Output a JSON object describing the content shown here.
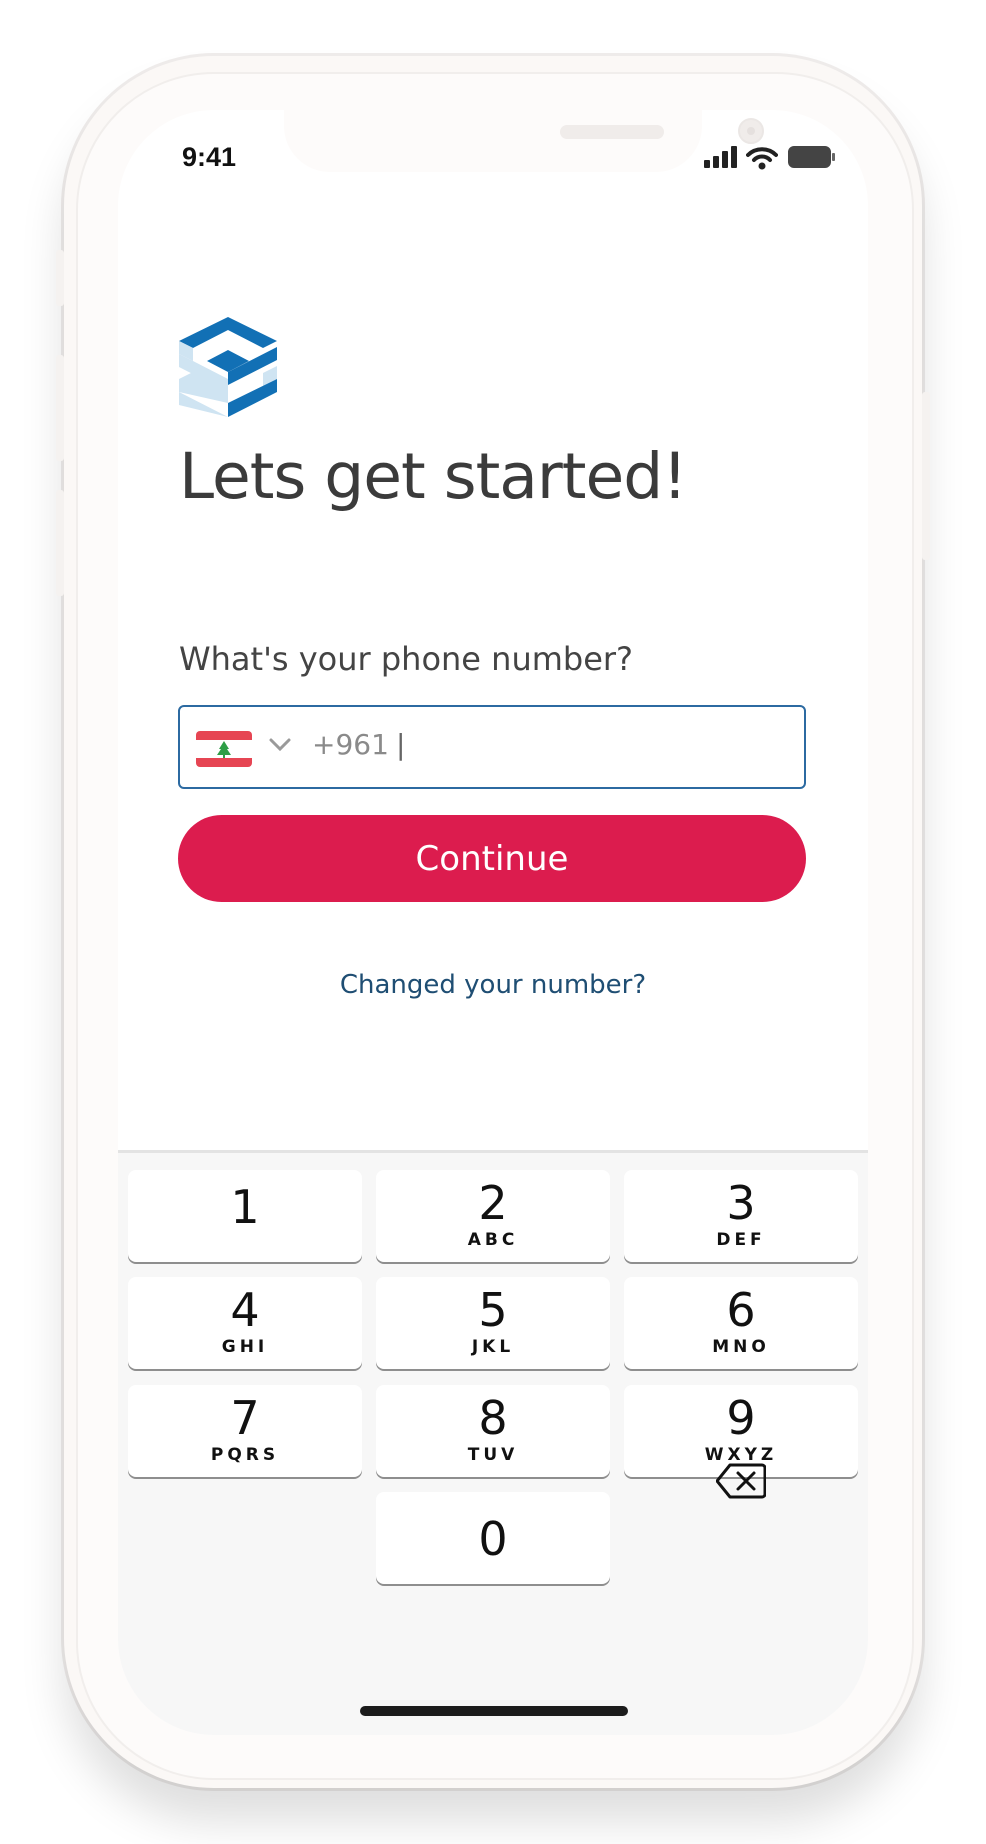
{
  "status_bar": {
    "time": "9:41",
    "icons": [
      "cellular-signal-icon",
      "wifi-icon",
      "battery-icon"
    ]
  },
  "brand": {
    "logo_icon": "brand-cube-logo-icon",
    "colors": [
      "#0f6cb0",
      "#cfe4f2"
    ]
  },
  "heading": "Lets get started!",
  "phone": {
    "label": "What's your phone number?",
    "country_flag": "lebanon-flag-icon",
    "dial_code": "+961",
    "caret": "|"
  },
  "continue_button": {
    "label": "Continue",
    "color": "#dc1c4e"
  },
  "changed_number_link": "Changed your number?",
  "keypad": {
    "keys": [
      {
        "num": "1",
        "letters": ""
      },
      {
        "num": "2",
        "letters": "ABC"
      },
      {
        "num": "3",
        "letters": "DEF"
      },
      {
        "num": "4",
        "letters": "GHI"
      },
      {
        "num": "5",
        "letters": "JKL"
      },
      {
        "num": "6",
        "letters": "MNO"
      },
      {
        "num": "7",
        "letters": "PQRS"
      },
      {
        "num": "8",
        "letters": "TUV"
      },
      {
        "num": "9",
        "letters": "WXYZ"
      },
      {
        "num": "0",
        "letters": ""
      }
    ],
    "backspace_icon": "backspace-icon"
  }
}
